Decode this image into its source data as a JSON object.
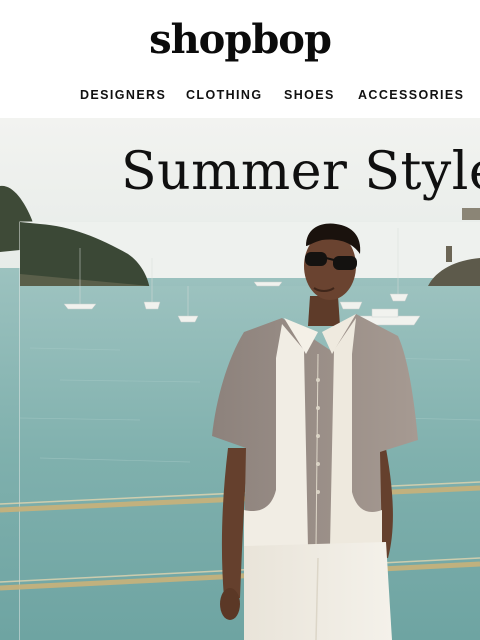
{
  "brand": {
    "logo_text": "shopbop"
  },
  "nav": {
    "items": [
      {
        "label": "DESIGNERS"
      },
      {
        "label": "CLOTHING"
      },
      {
        "label": "SHOES"
      },
      {
        "label": "ACCESSORIES"
      }
    ]
  },
  "hero": {
    "title": "Summer Style",
    "image_subject": "man in two-tone short-sleeve shirt by the sea"
  },
  "colors": {
    "sea": "#7fb3b0",
    "sky": "#eef1ef",
    "shirt_taupe": "#9d918a",
    "shirt_cream": "#f1ede4",
    "skin": "#6a4330",
    "railing": "#c8b47a"
  }
}
